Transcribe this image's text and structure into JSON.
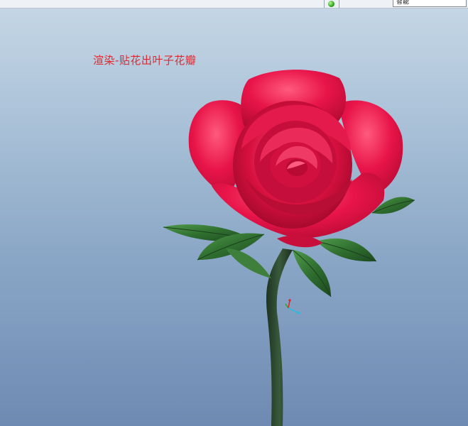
{
  "toolbar": {
    "filter_value": "智能",
    "status_icon": "green-light-icon"
  },
  "viewport": {
    "annotation": "渲染-贴花出叶子花瓣",
    "model_icon": "rose-model",
    "axis_icon": "coordinate-axes-icon",
    "background_top": "#c4d6e5",
    "background_bottom": "#6f8ab2",
    "annotation_color": "#e0282e"
  }
}
